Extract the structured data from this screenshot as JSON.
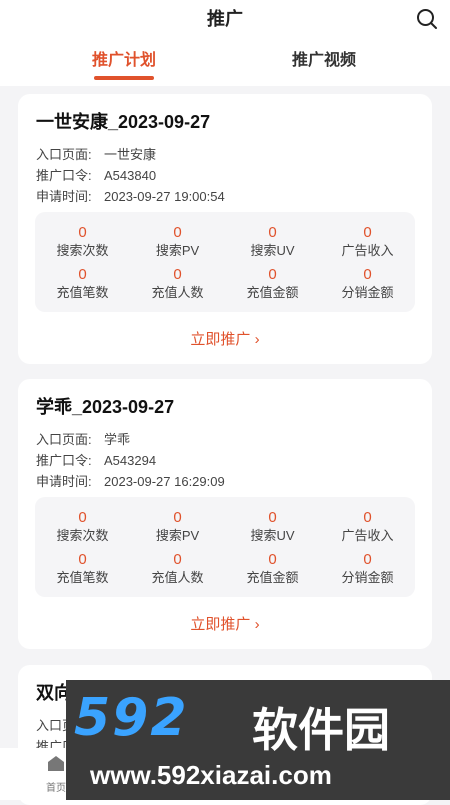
{
  "header": {
    "title": "推广"
  },
  "tabs": [
    {
      "label": "推广计划",
      "active": true
    },
    {
      "label": "推广视频",
      "active": false
    }
  ],
  "cards": [
    {
      "title": "一世安康_2023-09-27",
      "entry_label": "入口页面:",
      "entry_value": "一世安康",
      "code_label": "推广口令:",
      "code_value": "A543840",
      "time_label": "申请时间:",
      "time_value": "2023-09-27 19:00:54",
      "stats": [
        {
          "value": "0",
          "label": "搜索次数"
        },
        {
          "value": "0",
          "label": "搜索PV"
        },
        {
          "value": "0",
          "label": "搜索UV"
        },
        {
          "value": "0",
          "label": "广告收入"
        },
        {
          "value": "0",
          "label": "充值笔数"
        },
        {
          "value": "0",
          "label": "充值人数"
        },
        {
          "value": "0",
          "label": "充值金额"
        },
        {
          "value": "0",
          "label": "分销金额"
        }
      ],
      "action": "立即推广 ›"
    },
    {
      "title": "学乖_2023-09-27",
      "entry_label": "入口页面:",
      "entry_value": "学乖",
      "code_label": "推广口令:",
      "code_value": "A543294",
      "time_label": "申请时间:",
      "time_value": "2023-09-27 16:29:09",
      "stats": [
        {
          "value": "0",
          "label": "搜索次数"
        },
        {
          "value": "0",
          "label": "搜索PV"
        },
        {
          "value": "0",
          "label": "搜索UV"
        },
        {
          "value": "0",
          "label": "广告收入"
        },
        {
          "value": "0",
          "label": "充值笔数"
        },
        {
          "value": "0",
          "label": "充值人数"
        },
        {
          "value": "0",
          "label": "充值金额"
        },
        {
          "value": "0",
          "label": "分销金额"
        }
      ],
      "action": "立即推广 ›"
    },
    {
      "title": "双向",
      "entry_label": "入口页",
      "code_label": "推广口"
    }
  ],
  "bottom_nav": {
    "home_label": "首页"
  },
  "watermark": {
    "big": "592",
    "cn": "软件园",
    "url": "www.592xiazai.com"
  },
  "colors": {
    "accent": "#e0522c",
    "background": "#f4f4f6"
  },
  "icons": {
    "search": "search-icon",
    "home": "home-icon"
  }
}
